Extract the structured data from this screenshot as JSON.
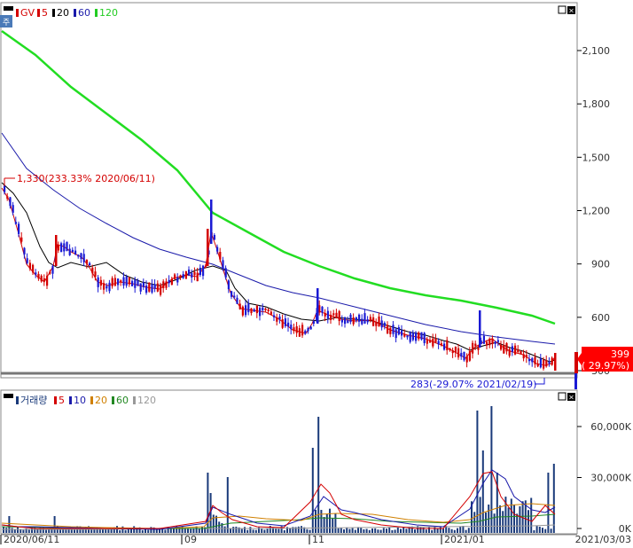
{
  "price_panel": {
    "legend": [
      {
        "label": "GV",
        "color": "#d40000"
      },
      {
        "label": "5",
        "color": "#d40000"
      },
      {
        "label": "20",
        "color": "#000000"
      },
      {
        "label": "60",
        "color": "#1a1aaa"
      },
      {
        "label": "120",
        "color": "#22cc22"
      }
    ],
    "high_annotation": "1,330(233.33% 2020/06/11)",
    "low_annotation": "283(-29.07% 2021/02/19)",
    "current_value": "399",
    "current_change": "( 29.97%)",
    "y_ticks": [
      "2,100",
      "1,800",
      "1,500",
      "1,200",
      "900",
      "600",
      "300"
    ]
  },
  "volume_panel": {
    "legend": [
      {
        "label": "거래량",
        "color": "#1a3a7a"
      },
      {
        "label": "5",
        "color": "#d40000"
      },
      {
        "label": "10",
        "color": "#1a1aaa"
      },
      {
        "label": "20",
        "color": "#d08000"
      },
      {
        "label": "60",
        "color": "#228822"
      },
      {
        "label": "120",
        "color": "#999999"
      }
    ],
    "y_ticks": [
      "60,000K",
      "30,000K",
      "0K"
    ]
  },
  "x_axis": {
    "labels": [
      "2020/06/11",
      "09",
      "11",
      "2021/01"
    ],
    "end_label": "2021/03/03"
  },
  "colors": {
    "up": "#d40000",
    "down": "#1a1ad4",
    "volume": "#1a3a7a",
    "ma120": "#22dd22"
  },
  "chart_data": [
    {
      "type": "candlestick",
      "title": "",
      "ylim": [
        260,
        2280
      ],
      "y_ticks": [
        2100,
        1800,
        1500,
        1200,
        900,
        600,
        300
      ],
      "x": [
        "2020/06/11",
        "2020/09",
        "2020/11",
        "2021/01",
        "2021/03/03"
      ],
      "close_approx": [
        1330,
        850,
        760,
        960,
        1050,
        780,
        720,
        1250,
        620,
        580,
        520,
        650,
        560,
        520,
        420,
        560,
        380,
        283,
        399
      ],
      "series": [
        {
          "name": "5",
          "color": "#d40000"
        },
        {
          "name": "20",
          "color": "#000000"
        },
        {
          "name": "60",
          "color": "#1a1aaa",
          "values": [
            1630,
            1350,
            1150,
            1000,
            920,
            870,
            790,
            700,
            640,
            590,
            560,
            510,
            460
          ]
        },
        {
          "name": "120",
          "color": "#22dd22",
          "values": [
            2200,
            1650,
            1300,
            1050,
            870,
            780,
            700,
            640,
            600,
            570
          ]
        }
      ],
      "annotations": [
        "1,330(233.33% 2020/06/11)",
        "283(-29.07% 2021/02/19)",
        "399 (29.97%)"
      ]
    },
    {
      "type": "bar",
      "title": "",
      "ylim": [
        0,
        72000
      ],
      "y_ticks": [
        60000,
        30000,
        0
      ],
      "y_unit": "K",
      "series": [
        {
          "name": "거래량",
          "color": "#1a3a7a"
        },
        {
          "name": "5",
          "color": "#d40000"
        },
        {
          "name": "10",
          "color": "#1a1aaa"
        },
        {
          "name": "20",
          "color": "#d08000"
        },
        {
          "name": "60",
          "color": "#228822"
        },
        {
          "name": "120",
          "color": "#999999"
        }
      ]
    }
  ]
}
